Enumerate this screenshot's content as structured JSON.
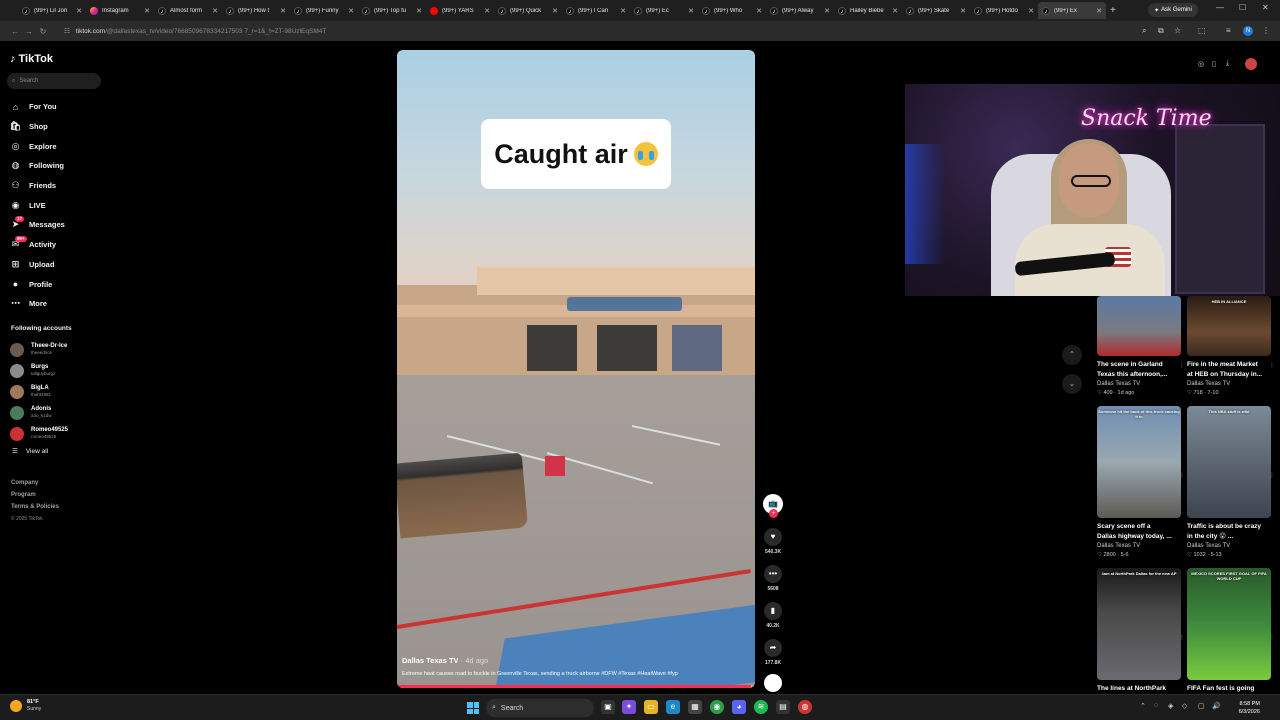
{
  "browser": {
    "tabs": [
      {
        "label": "(99+) Lil Jon",
        "icon": "tiktok-icon"
      },
      {
        "label": "Instagram",
        "icon": "instagram-icon"
      },
      {
        "label": "Almost form",
        "icon": "tiktok-icon"
      },
      {
        "label": "(99+) How t",
        "icon": "tiktok-icon"
      },
      {
        "label": "(99+) Funny",
        "icon": "tiktok-icon"
      },
      {
        "label": "(99+) Top fu",
        "icon": "tiktok-icon"
      },
      {
        "label": "(99+) YARS",
        "icon": "youtube-icon"
      },
      {
        "label": "(99+) Quick",
        "icon": "tiktok-icon"
      },
      {
        "label": "(99+) I Can",
        "icon": "tiktok-icon"
      },
      {
        "label": "(99+) Ec",
        "icon": "tiktok-icon"
      },
      {
        "label": "(99+) Who",
        "icon": "tiktok-icon"
      },
      {
        "label": "(99+) Alway",
        "icon": "tiktok-icon"
      },
      {
        "label": "Hailey Biebe",
        "icon": "tiktok-icon"
      },
      {
        "label": "(99+) Skate",
        "icon": "tiktok-icon"
      },
      {
        "label": "(99+) Hotdo",
        "icon": "tiktok-icon"
      },
      {
        "label": "(99+) Ex",
        "icon": "tiktok-icon"
      }
    ],
    "ask_gemini": "Ask Gemini",
    "url_host": "tiktok.com",
    "url_path": "/@dallastexas_tv/video/7668509678334217503 7_r=1&_t=ZT-98UzlEqSM4T"
  },
  "sidebar": {
    "logo": "TikTok",
    "search_placeholder": "Search",
    "nav": [
      {
        "label": "For You",
        "icon": "home-icon"
      },
      {
        "label": "Shop",
        "icon": "shop-icon"
      },
      {
        "label": "Explore",
        "icon": "compass-icon"
      },
      {
        "label": "Following",
        "icon": "following-icon"
      },
      {
        "label": "Friends",
        "icon": "friends-icon"
      },
      {
        "label": "LIVE",
        "icon": "live-icon"
      },
      {
        "label": "Messages",
        "icon": "message-icon",
        "badge": "17"
      },
      {
        "label": "Activity",
        "icon": "activity-icon",
        "badge": "99+"
      },
      {
        "label": "Upload",
        "icon": "upload-icon"
      },
      {
        "label": "Profile",
        "icon": "profile-icon"
      },
      {
        "label": "More",
        "icon": "more-icon"
      }
    ],
    "following_title": "Following accounts",
    "accounts": [
      {
        "name": "Theee-Dr-Ice",
        "handle": "theeedrice",
        "color": "#6b5a4e"
      },
      {
        "name": "Burgs",
        "handle": "tallguyburgz",
        "color": "#8b8b8b"
      },
      {
        "name": "BigLA",
        "handle": "thebt2891",
        "color": "#a0785a"
      },
      {
        "name": "Adonis",
        "handle": "a3o_k1dw",
        "color": "#4c7a5a"
      },
      {
        "name": "Romeo49525",
        "handle": "romeo49525",
        "color": "#c83232"
      }
    ],
    "view_all": "View all",
    "footer": [
      "Company",
      "Program",
      "Terms & Policies"
    ],
    "copyright": "© 2025 TikTok"
  },
  "video": {
    "caption": "Caught air",
    "author": "Dallas Texas TV",
    "age": "· 4d ago",
    "description": "Extreme heat causes road to buckle in Greenville Texas, sending a truck airborne #DFW #Texas #HeatWave #fyp",
    "progress": 0.99
  },
  "actions": {
    "likes": "540.3K",
    "comments": "5608",
    "saves": "40.2K",
    "shares": "177.8K"
  },
  "related": [
    {
      "title": "The scene in Garland\nTexas this afternoon,...",
      "author": "Dallas Texas TV",
      "stats": "♡ 409 · 1d ago",
      "bg": "linear-gradient(180deg,#5a7aa3,#7a7a80 60%,#b02a2a)",
      "thumb_text": ""
    },
    {
      "title": "Fire in the meat Market\nat HEB on Thursday in...",
      "author": "Dallas Texas TV",
      "stats": "♡ 718 · 7-10",
      "bg": "linear-gradient(180deg,#2a1d14,#6b4a30 60%,#3a2a1e)",
      "thumb_text": "HEB IN ALLIANCE"
    },
    {
      "title": "Scary scene off a\nDallas highway today, ...",
      "author": "Dallas Texas TV",
      "stats": "♡ 2800 · 5-6",
      "bg": "linear-gradient(180deg,#6f8fb3,#9aa8b0 50%,#5d5a55)",
      "thumb_text": "Someone hit the back of this truck causing it to"
    },
    {
      "title": "Traffic is about be crazy\nin the city 😮 ...",
      "author": "Dallas Texas TV",
      "stats": "♡ 1032 · 5-13",
      "bg": "linear-gradient(180deg,#7a8a98,#5d6670 50%,#3c4550)",
      "thumb_text": "This NBA stuff is wild"
    },
    {
      "title": "The lines at NorthPark",
      "author": "",
      "stats": "",
      "bg": "linear-gradient(180deg,#1a1a1a,#4a4a4a 40%,#6a6a70)",
      "thumb_text": "4am at NorthPark Dallas for the new AP"
    },
    {
      "title": "FIFA Fan fest is going",
      "author": "",
      "stats": "",
      "bg": "linear-gradient(180deg,#2a5a2a,#3e8a3e 50%,#7acb3e)",
      "thumb_text": "MEXICO SCORES FIRST GOAL OF FIFA WORLD CUP"
    }
  ],
  "webcam": {
    "neon_sign": "Snack Time"
  },
  "taskbar": {
    "temp": "81°F",
    "condition": "Sunny",
    "search": "Search",
    "time": "8:58 PM",
    "date": "6/3/2026"
  }
}
